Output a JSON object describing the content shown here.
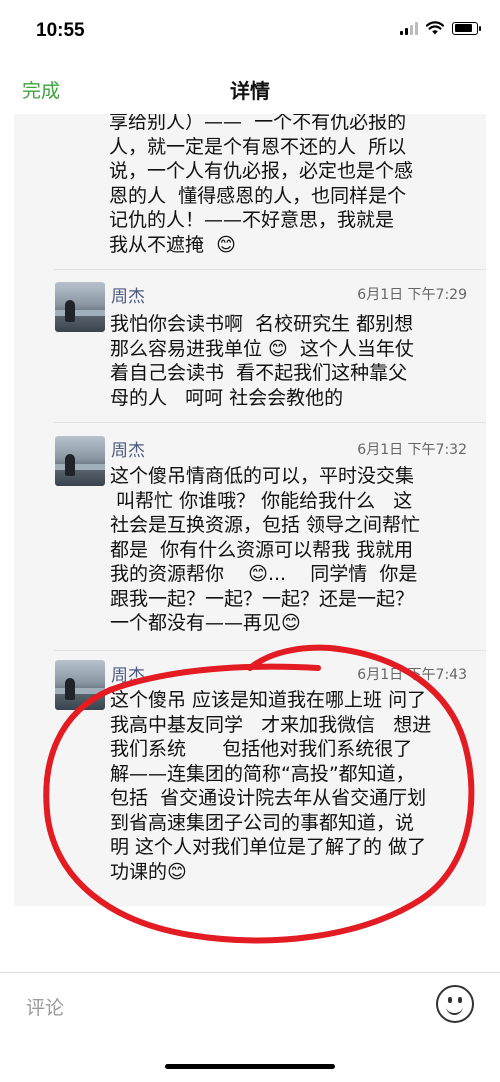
{
  "status_bar": {
    "time": "10:55"
  },
  "nav": {
    "done_label": "完成",
    "title": "详情"
  },
  "fragment": {
    "text": "享给别人）——  一个不有仇必报的\n人，就一定是个有恩不还的人  所以\n说，一个人有仇必报，必定也是个感\n恩的人  懂得感恩的人，也同样是个\n记仇的人！——不好意思，我就是\n我从不遮掩  😊"
  },
  "comments": [
    {
      "name": "周杰",
      "time": "6月1日  下午7:29",
      "text": "我怕你会读书啊  名校研究生 都别想\n那么容易进我单位 😊  这个人当年仗\n着自己会读书  看不起我们这种靠父\n母的人   呵呵 社会会教他的"
    },
    {
      "name": "周杰",
      "time": "6月1日  下午7:32",
      "text": "这个傻吊情商低的可以，平时没交集\n 叫帮忙 你谁哦？ 你能给我什么   这\n社会是互换资源，包括 领导之间帮忙\n都是  你有什么资源可以帮我 我就用\n我的资源帮你    😊...    同学情  你是\n跟我一起？一起？一起？还是一起？\n一个都没有——再见😊"
    },
    {
      "name": "周杰",
      "time": "6月1日  下午7:43",
      "text": "这个傻吊 应该是知道我在哪上班 问了\n我高中基友同学   才来加我微信   想进\n我们系统      包括他对我们系统很了\n解——连集团的简称“高投”都知道，\n包括  省交通设计院去年从省交通厅划\n到省高速集团子公司的事都知道，说\n明 这个人对我们单位是了解了的 做了\n功课的😊"
    }
  ],
  "input": {
    "placeholder": "评论"
  },
  "colors": {
    "accent_green": "#3fa33c",
    "name_blue": "#4a5a80",
    "annotation_red": "#e31b23"
  }
}
